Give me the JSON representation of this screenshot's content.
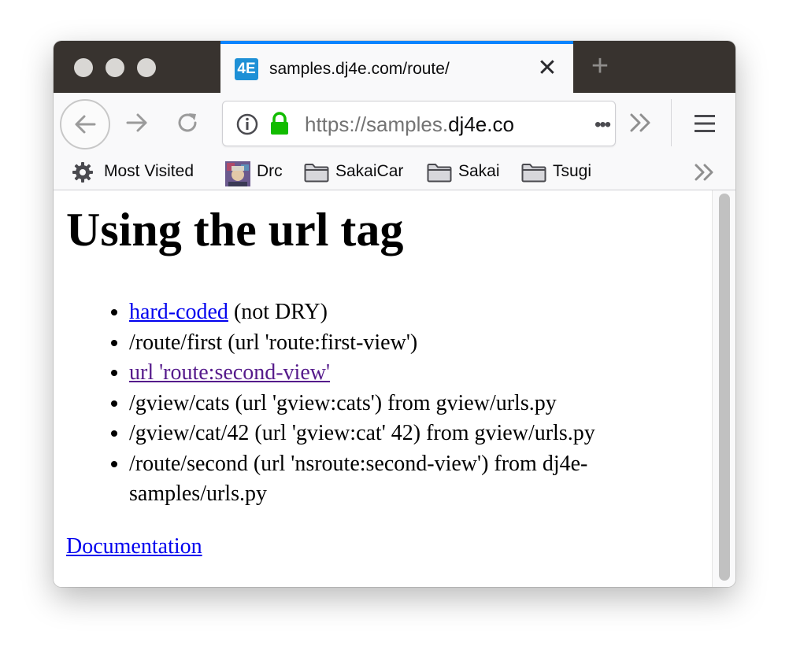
{
  "window": {
    "tab": {
      "favicon_text": "4E",
      "title": "samples.dj4e.com/route/",
      "close_glyph": "✕"
    },
    "new_tab_glyph": "+"
  },
  "toolbar": {
    "url": {
      "scheme_prefix": "https://samples.",
      "domain": "dj4e.co",
      "ellipsis": "•••"
    }
  },
  "bookmarks": {
    "items": [
      {
        "label": "Most Visited",
        "icon": "gear-icon"
      },
      {
        "label": "Drc",
        "icon": "avatar-favicon"
      },
      {
        "label": "SakaiCar",
        "icon": "folder-icon"
      },
      {
        "label": "Sakai",
        "icon": "folder-icon"
      },
      {
        "label": "Tsugi",
        "icon": "folder-icon"
      }
    ]
  },
  "page": {
    "heading": "Using the url tag",
    "list": {
      "item1_link": "hard-coded",
      "item1_text": " (not DRY)",
      "item2_text": "/route/first (url 'route:first-view')",
      "item3_link": "url 'route:second-view'",
      "item4_text": "/gview/cats (url 'gview:cats') from gview/urls.py",
      "item5_text": "/gview/cat/42 (url 'gview:cat' 42) from gview/urls.py",
      "item6_text": "/route/second (url 'nsroute:second-view') from dj4e-samples/urls.py"
    },
    "documentation_link": "Documentation"
  },
  "colors": {
    "titlebar": "#38332f",
    "tab_accent": "#0a84ff",
    "link": "#0000ee",
    "visited_link": "#551a8b",
    "lock_green": "#12bc00"
  }
}
